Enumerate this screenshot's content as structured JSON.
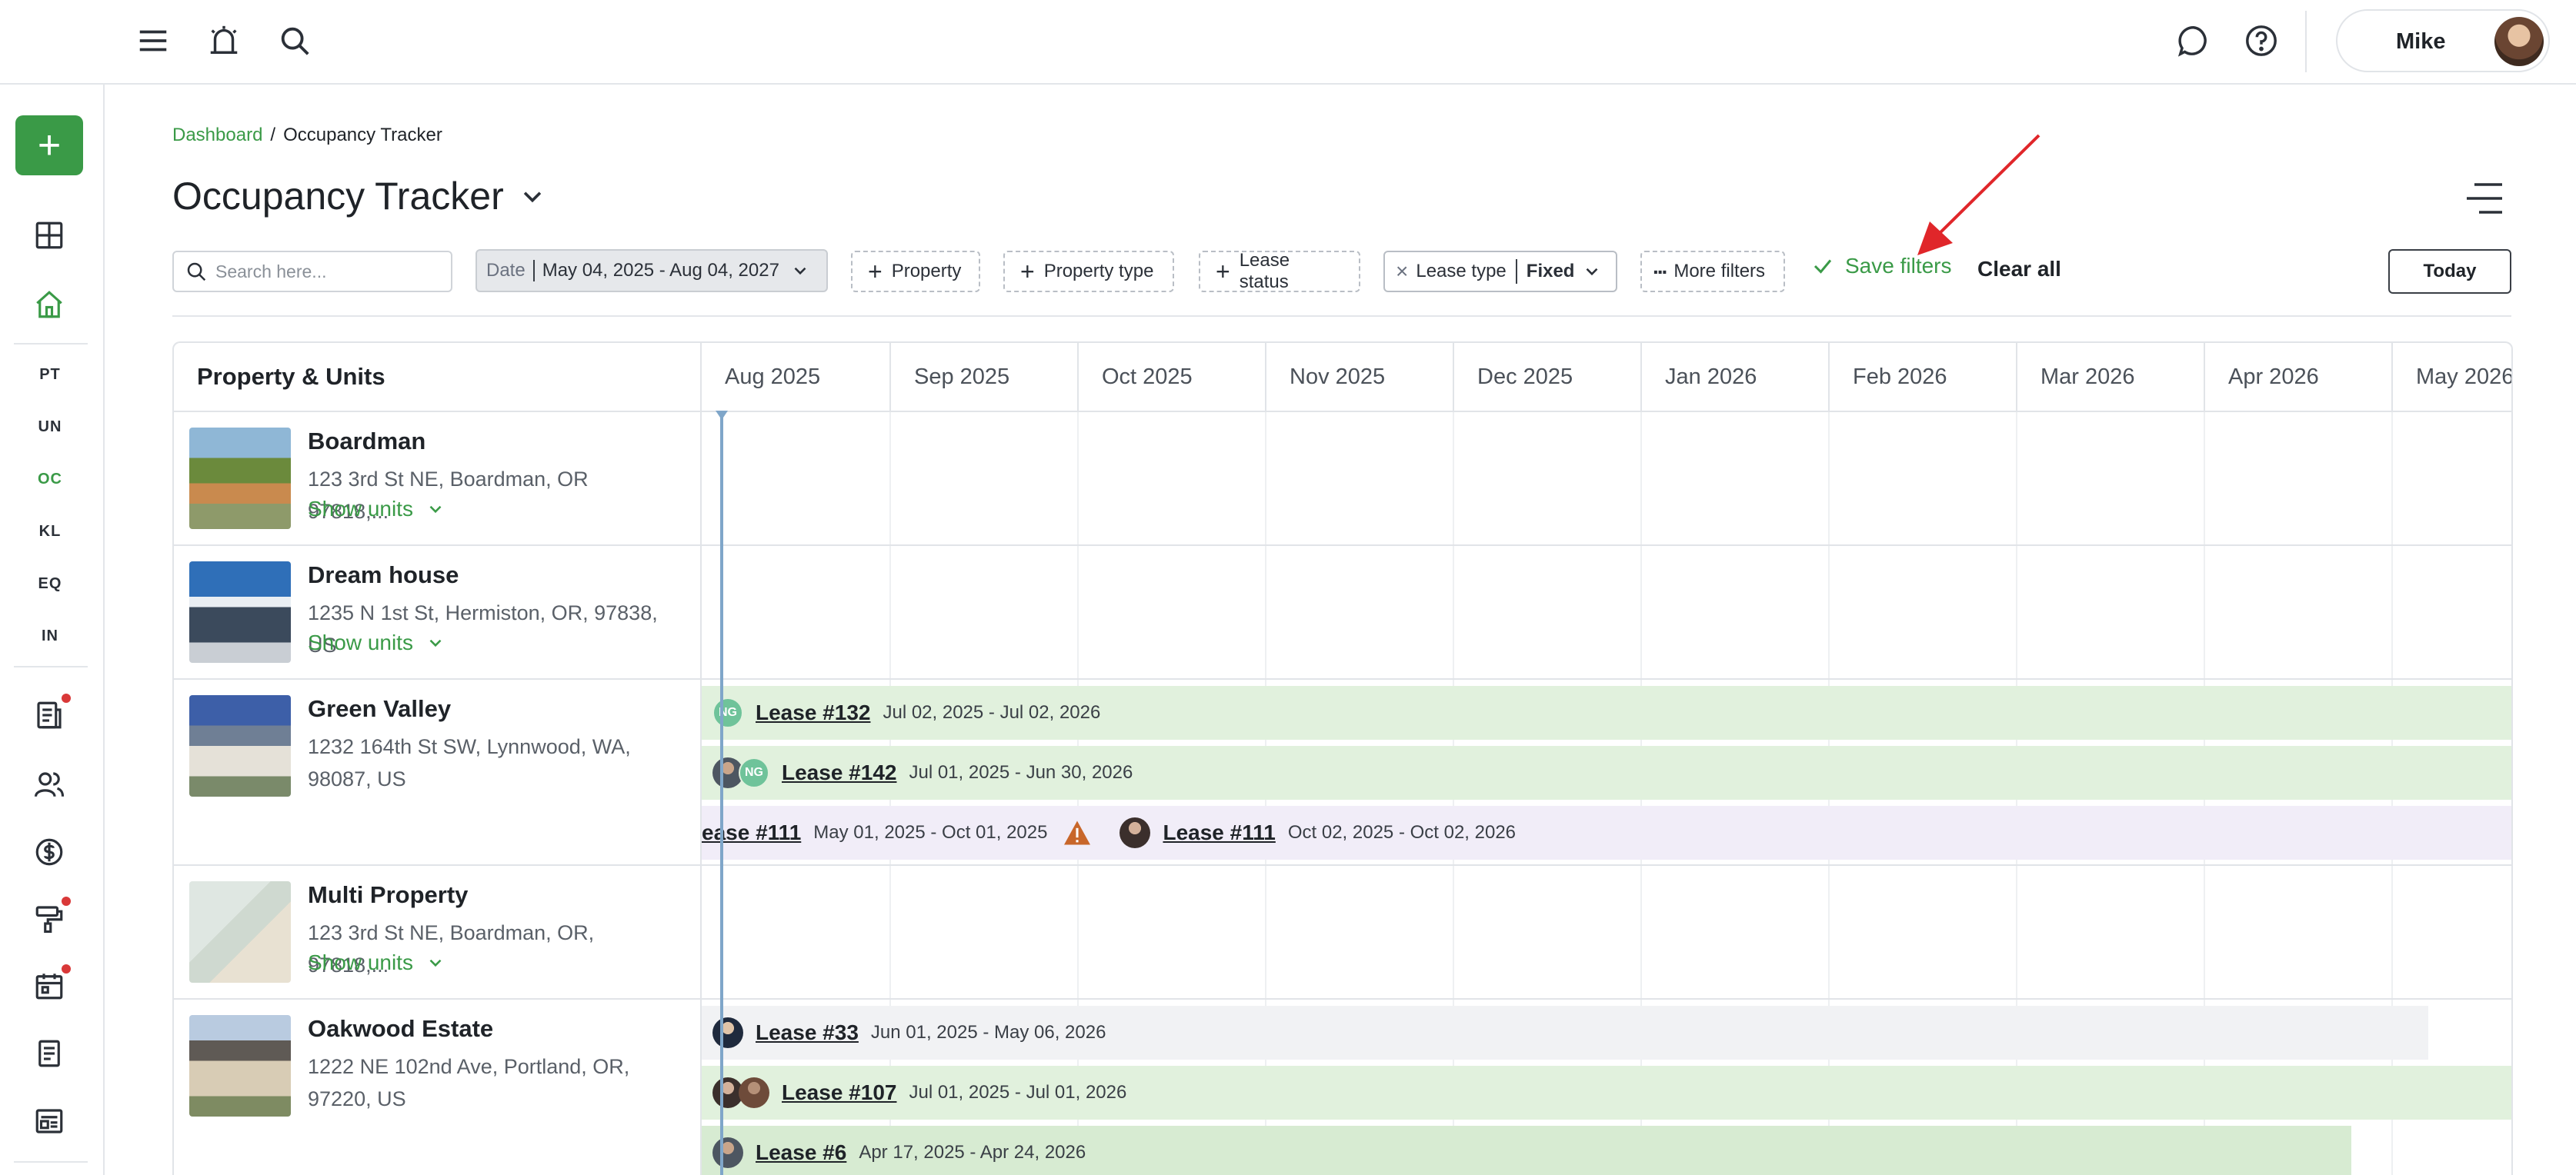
{
  "topbar": {
    "icons": [
      "menu-icon",
      "alarm-icon",
      "search-icon",
      "chat-icon",
      "help-icon"
    ],
    "user_name": "Mike"
  },
  "sidebar": {
    "add_label": "+",
    "nav_abbr": [
      "PT",
      "UN",
      "OC",
      "KL",
      "EQ",
      "IN"
    ],
    "active_abbr": "OC",
    "icons": [
      "dashboard-icon",
      "home-icon",
      "reports-icon",
      "contacts-icon",
      "accounting-icon",
      "maintenance-icon",
      "calendar-icon",
      "documents-icon",
      "listings-icon"
    ]
  },
  "breadcrumb": {
    "link": "Dashboard",
    "separator": "/",
    "current": "Occupancy Tracker"
  },
  "page_title": "Occupancy Tracker",
  "filters": {
    "search_placeholder": "Search here...",
    "date_label": "Date",
    "date_value": "May 04, 2025 - Aug 04, 2027",
    "property": "Property",
    "property_type": "Property type",
    "lease_status": "Lease status",
    "lease_type_label": "Lease type",
    "lease_type_value": "Fixed",
    "more_filters": "More filters",
    "save_filters": "Save filters",
    "clear_all": "Clear all",
    "today": "Today"
  },
  "table": {
    "column_title": "Property & Units",
    "months": [
      "Aug 2025",
      "Sep 2025",
      "Oct 2025",
      "Nov 2025",
      "Dec 2025",
      "Jan 2026",
      "Feb 2026",
      "Mar 2026",
      "Apr 2026",
      "May 2026"
    ],
    "properties": [
      {
        "name": "Boardman",
        "address": "123 3rd St NE, Boardman, OR 97818,...",
        "show_units": "Show units"
      },
      {
        "name": "Dream house",
        "address": "1235 N 1st St, Hermiston, OR, 97838, US",
        "show_units": "Show units"
      },
      {
        "name": "Green Valley",
        "address": "1232 164th St SW, Lynnwood, WA, 98087, US"
      },
      {
        "name": "Multi Property",
        "address": "123 3rd St NE, Boardman, OR, 97818,...",
        "show_units": "Show units"
      },
      {
        "name": "Oakwood Estate",
        "address": "1222 NE 102nd Ave, Portland, OR, 97220, US"
      }
    ],
    "leases": {
      "l132": {
        "id": "Lease #132",
        "dates": "Jul 02, 2025 - Jul 02, 2026",
        "initials": "NG"
      },
      "l142": {
        "id": "Lease #142",
        "dates": "Jul 01, 2025 - Jun 30, 2026",
        "initials": "NG"
      },
      "l111a": {
        "id": "ease #111",
        "dates": "May 01, 2025 - Oct 01, 2025"
      },
      "l111b": {
        "id": "Lease #111",
        "dates": "Oct 02, 2025 - Oct 02, 2026"
      },
      "l33": {
        "id": "Lease #33",
        "dates": "Jun 01, 2025 - May 06, 2026"
      },
      "l107": {
        "id": "Lease #107",
        "dates": "Jul 01, 2025 - Jul 01, 2026"
      },
      "l6": {
        "id": "Lease #6",
        "dates": "Apr 17, 2025 - Apr 24, 2026"
      }
    }
  },
  "colors": {
    "brand_green": "#3a9a47",
    "lease_green": "#e1f1dd",
    "lease_purple": "#f1edf8",
    "warning": "#c8662a",
    "annotation_arrow": "#e0262a"
  }
}
